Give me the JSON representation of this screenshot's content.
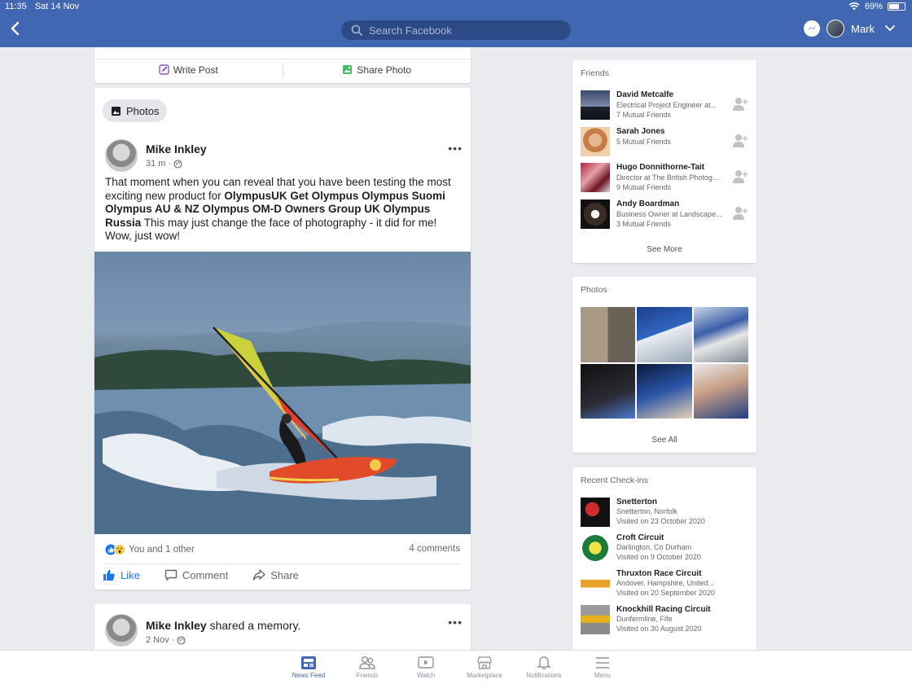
{
  "status": {
    "time": "11:35",
    "date": "Sat 14 Nov",
    "battery": "69%"
  },
  "header": {
    "search_placeholder": "Search Facebook",
    "user_name": "Mark"
  },
  "composer": {
    "write_post": "Write Post",
    "share_photo": "Share Photo"
  },
  "post": {
    "section_chip": "Photos",
    "author": "Mike Inkley",
    "time": "31 m",
    "text_parts": [
      {
        "t": "That moment when you can reveal that you have been testing the most exciting new product for ",
        "b": false
      },
      {
        "t": "OlympusUK Get Olympus Olympus Suomi Olympus AU & NZ Olympus OM-D Owners Group UK Olympus Russia",
        "b": true
      },
      {
        "t": " This may just change the face of photography - it did for me! Wow, just wow!",
        "b": false
      }
    ],
    "reactions": "You and 1 other",
    "comments": "4 comments",
    "actions": {
      "like": "Like",
      "comment": "Comment",
      "share": "Share"
    }
  },
  "post2": {
    "author": "Mike Inkley",
    "suffix": "shared a memory.",
    "time": "2 Nov"
  },
  "friends": {
    "title": "Friends",
    "items": [
      {
        "name": "David Metcalfe",
        "line1": "Electrical Project Engineer at...",
        "line2": "7 Mutual Friends"
      },
      {
        "name": "Sarah Jones",
        "line1": "5 Mutual Friends",
        "line2": ""
      },
      {
        "name": "Hugo Donnithorne-Tait",
        "line1": "Director at The British Photog...",
        "line2": "9 Mutual Friends"
      },
      {
        "name": "Andy Boardman",
        "line1": "Business Owner at Landscape...",
        "line2": "3 Mutual Friends"
      }
    ],
    "see_more": "See More"
  },
  "photos": {
    "title": "Photos",
    "see_all": "See All"
  },
  "checkins": {
    "title": "Recent Check-ins",
    "items": [
      {
        "name": "Snetterton",
        "location": "Snetterton, Norfolk",
        "visited": "Visited on 23 October 2020"
      },
      {
        "name": "Croft Circuit",
        "location": "Darlington, Co Durham",
        "visited": "Visited on 9 October 2020"
      },
      {
        "name": "Thruxton Race Circuit",
        "location": "Andover, Hampshire, United...",
        "visited": "Visited on 20 September 2020"
      },
      {
        "name": "Knockhill Racing Circuit",
        "location": "Dunfermline, Fife",
        "visited": "Visited on 30 August 2020"
      }
    ]
  },
  "tabs": [
    {
      "label": "News Feed",
      "icon": "news-feed-icon"
    },
    {
      "label": "Friends",
      "icon": "friends-icon"
    },
    {
      "label": "Watch",
      "icon": "watch-icon"
    },
    {
      "label": "Marketplace",
      "icon": "marketplace-icon"
    },
    {
      "label": "Notifications",
      "icon": "bell-icon"
    },
    {
      "label": "Menu",
      "icon": "menu-icon"
    }
  ],
  "colors": {
    "brand": "#4267b2",
    "like": "#1877f2",
    "background": "#e9ebee"
  }
}
